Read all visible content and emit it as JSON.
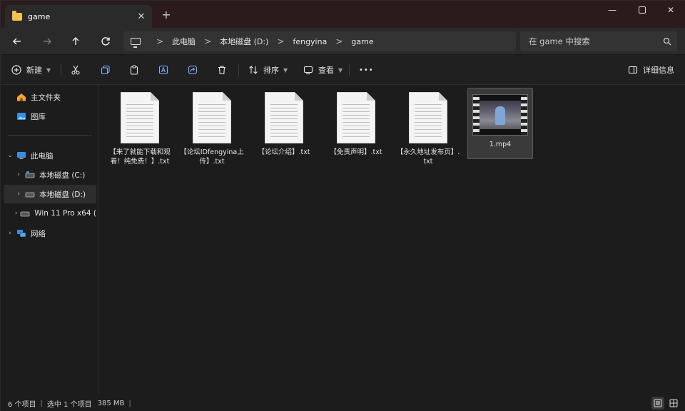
{
  "tab": {
    "title": "game",
    "close": "✕",
    "new_tab": "+"
  },
  "window_controls": {
    "minimize": "—",
    "close": "✕"
  },
  "address": {
    "breadcrumbs": [
      "此电脑",
      "本地磁盘 (D:)",
      "fengyina",
      "game"
    ],
    "separator": ">"
  },
  "search": {
    "placeholder": "在 game 中搜索"
  },
  "toolbar": {
    "new_label": "新建",
    "sort_label": "排序",
    "view_label": "查看",
    "more_label": "•••",
    "details_label": "详细信息"
  },
  "sidebar": {
    "home": "主文件夹",
    "gallery": "图库",
    "this_pc": "此电脑",
    "drive_c": "本地磁盘 (C:)",
    "drive_d": "本地磁盘 (D:)",
    "drive_usb": "Win 11 Pro x64 (",
    "network": "网络"
  },
  "files": [
    {
      "name": "【来了就能下载和观看！纯免费！】.txt",
      "type": "txt"
    },
    {
      "name": "【论坛IDfengyina上传】.txt",
      "type": "txt"
    },
    {
      "name": "【论坛介绍】.txt",
      "type": "txt"
    },
    {
      "name": "【免责声明】.txt",
      "type": "txt"
    },
    {
      "name": "【永久地址发布页】.txt",
      "type": "txt"
    },
    {
      "name": "1.mp4",
      "type": "video",
      "selected": true
    }
  ],
  "status": {
    "count": "6 个项目",
    "selection": "选中 1 个项目",
    "size": "385 MB"
  },
  "colors": {
    "folder": "#f2c14e",
    "titlebar": "#2b1b1c",
    "background": "#1c1c1c"
  }
}
